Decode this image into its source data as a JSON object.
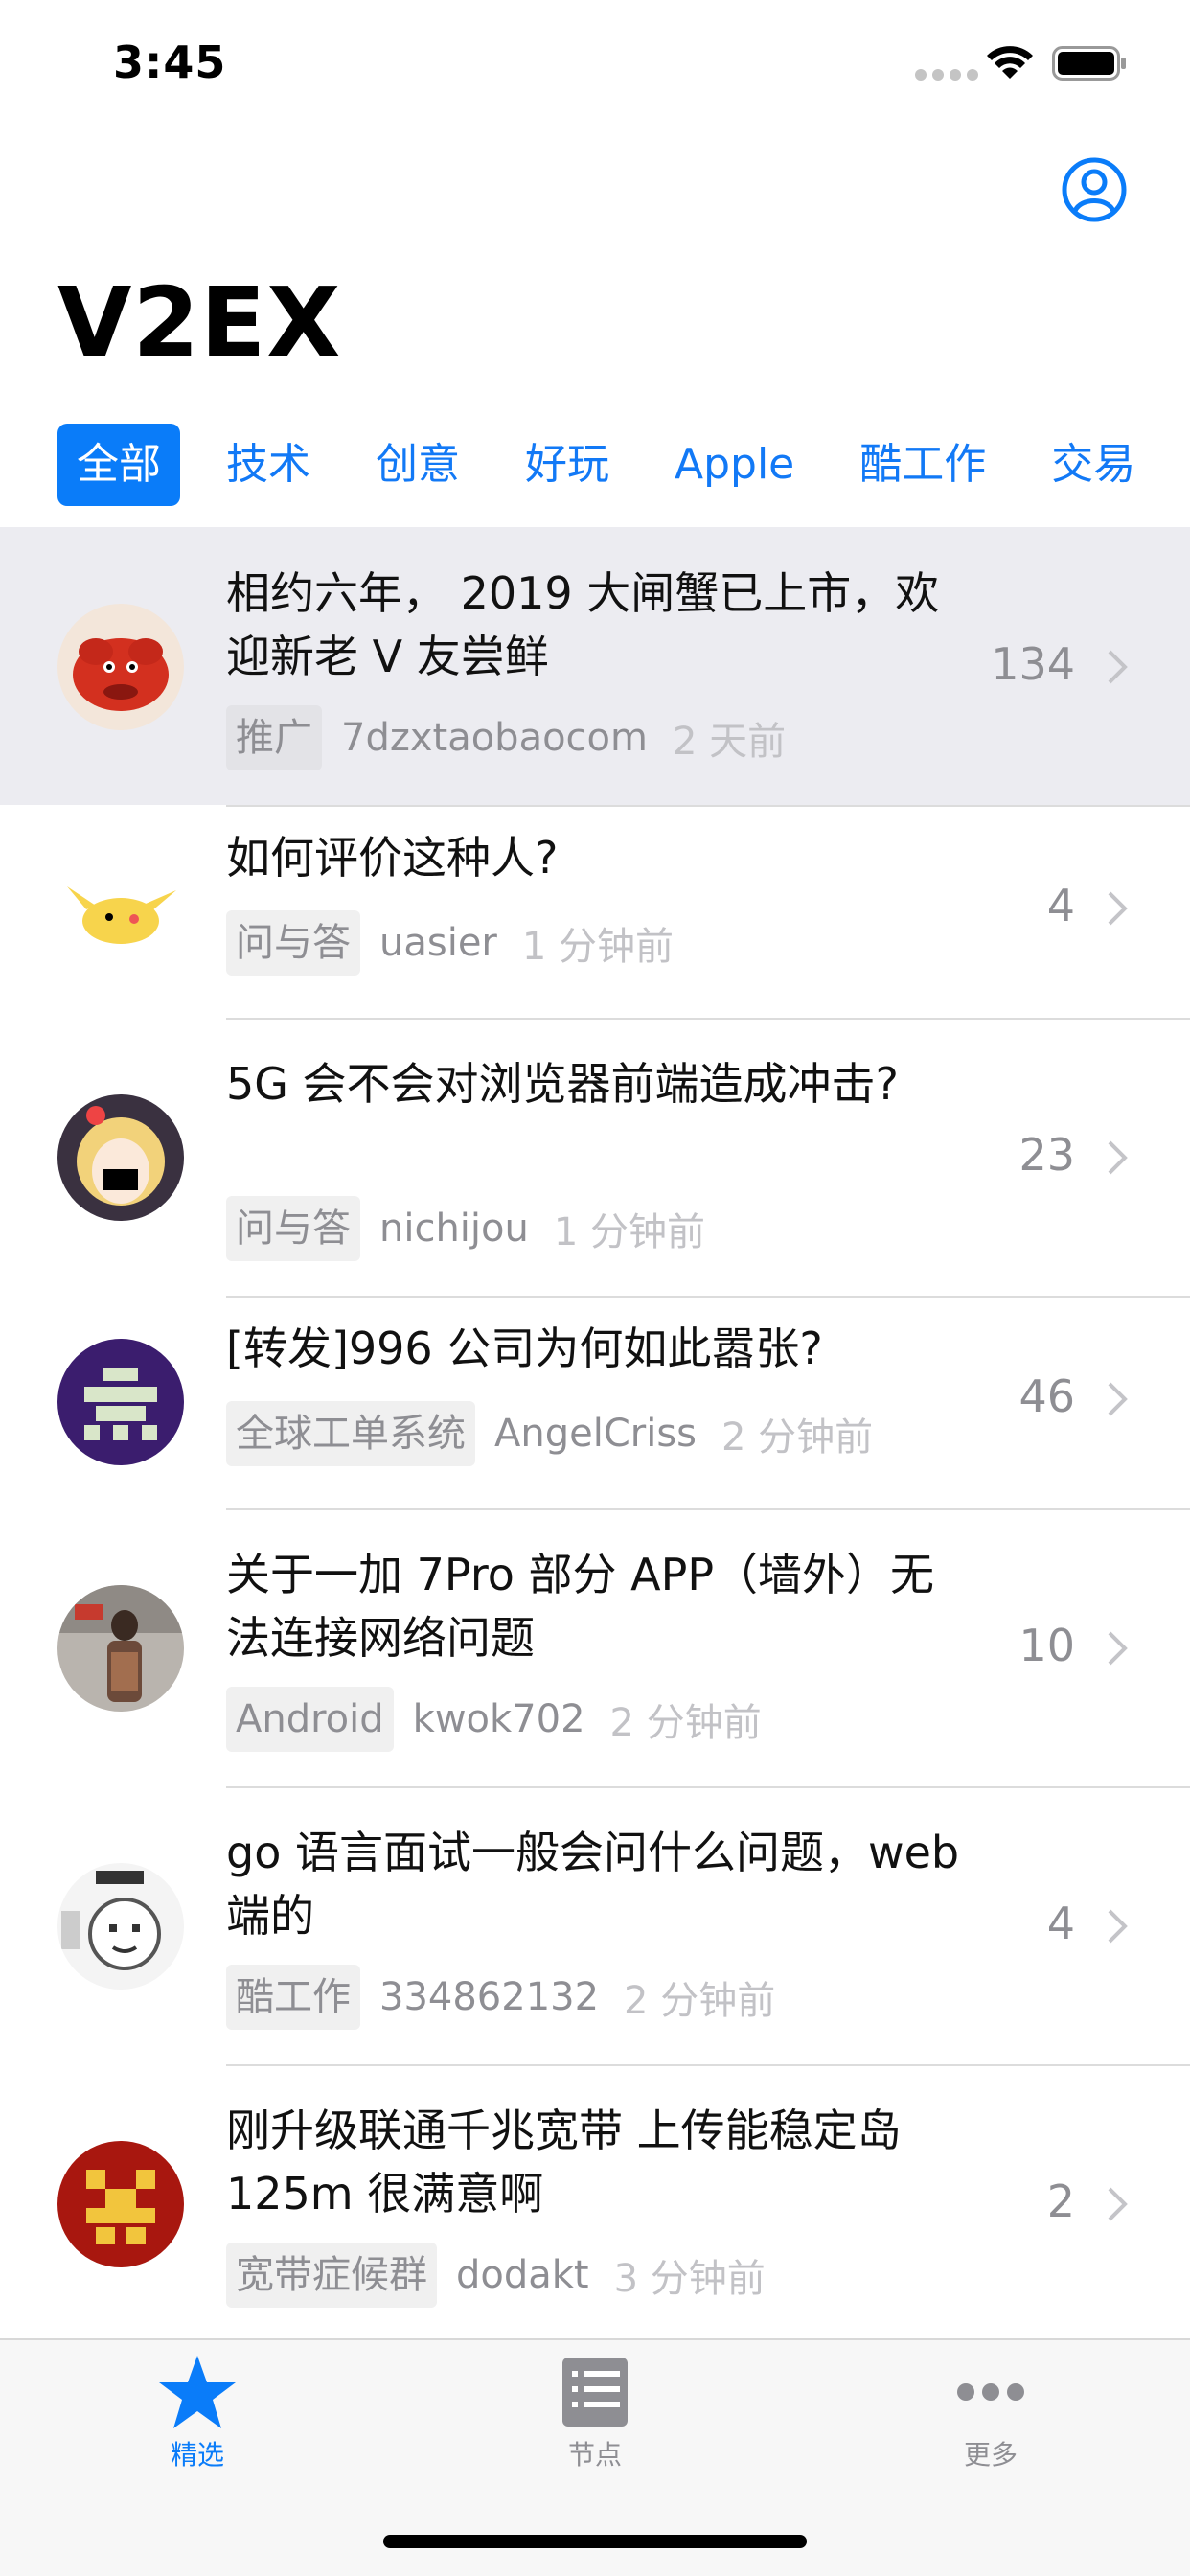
{
  "status_bar": {
    "time": "3:45"
  },
  "header": {
    "title": "V2EX"
  },
  "tabs": [
    {
      "label": "全部"
    },
    {
      "label": "技术"
    },
    {
      "label": "创意"
    },
    {
      "label": "好玩"
    },
    {
      "label": "Apple"
    },
    {
      "label": "酷工作"
    },
    {
      "label": "交易"
    }
  ],
  "topics": [
    {
      "title": "相约六年， 2019 大闸蟹已上市，欢迎新老 V 友尝鲜",
      "node": "推广",
      "user": "7dzxtaobaocom",
      "time": "2 天前",
      "replies": "134",
      "avatar": "crab-avatar"
    },
    {
      "title": "如何评价这种人?",
      "node": "问与答",
      "user": "uasier",
      "time": "1 分钟前",
      "replies": "4",
      "avatar": "pikachu-avatar"
    },
    {
      "title": "5G 会不会对浏览器前端造成冲击?",
      "node": "问与答",
      "user": "nichijou",
      "time": "1 分钟前",
      "replies": "23",
      "avatar": "anime-girl-avatar"
    },
    {
      "title": "[转发]996 公司为何如此嚣张?",
      "node": "全球工单系统",
      "user": "AngelCriss",
      "time": "2 分钟前",
      "replies": "46",
      "avatar": "pixel-purple-avatar"
    },
    {
      "title": "关于一加 7Pro 部分 APP（墙外）无法连接网络问题",
      "node": "Android",
      "user": "kwok702",
      "time": "2 分钟前",
      "replies": "10",
      "avatar": "photo-avatar"
    },
    {
      "title": "go 语言面试一般会问什么问题，web 端的",
      "node": "酷工作",
      "user": "334862132",
      "time": "2 分钟前",
      "replies": "4",
      "avatar": "sketch-face-avatar"
    },
    {
      "title": "刚升级联通千兆宽带 上传能稳定岛 125m 很满意啊",
      "node": "宽带症候群",
      "user": "dodakt",
      "time": "3 分钟前",
      "replies": "2",
      "avatar": "pixel-red-avatar"
    }
  ],
  "tab_bar": {
    "items": [
      {
        "label": "精选",
        "icon": "star-icon",
        "active": true
      },
      {
        "label": "节点",
        "icon": "list-icon",
        "active": false
      },
      {
        "label": "更多",
        "icon": "more-icon",
        "active": false
      }
    ]
  },
  "colors": {
    "accent": "#0a7cf9",
    "highlight_row": "#ececf1",
    "secondary_text": "#8e8e93"
  }
}
